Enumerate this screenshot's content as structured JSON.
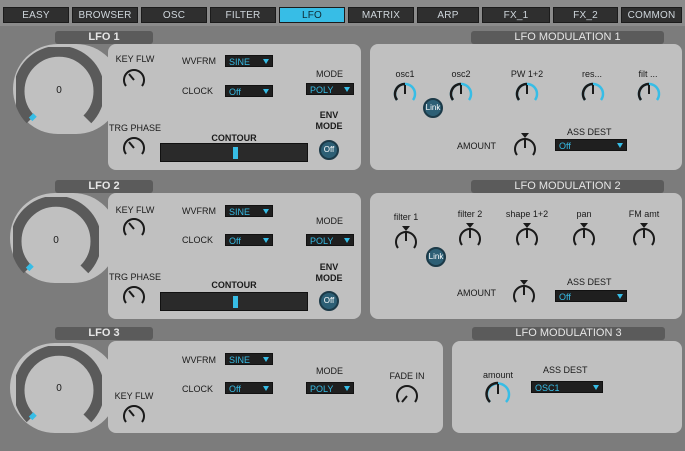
{
  "tabs": [
    "EASY",
    "BROWSER",
    "OSC",
    "FILTER",
    "LFO",
    "MATRIX",
    "ARP",
    "FX_1",
    "FX_2",
    "COMMON"
  ],
  "active_tab": "LFO",
  "accent": "#37bde6",
  "lfo1": {
    "title": "LFO 1",
    "rate_value": "0",
    "key_flw_label": "KEY FLW",
    "trg_phase_label": "TRG PHASE",
    "wvfrm_label": "WVFRM",
    "wvfrm_value": "SINE",
    "clock_label": "CLOCK",
    "clock_value": "Off",
    "mode_label": "MODE",
    "mode_value": "POLY",
    "contour_label": "CONTOUR",
    "env_mode_label1": "ENV",
    "env_mode_label2": "MODE",
    "env_mode_value": "Off"
  },
  "lfo2": {
    "title": "LFO 2",
    "rate_value": "0",
    "key_flw_label": "KEY FLW",
    "trg_phase_label": "TRG PHASE",
    "wvfrm_label": "WVFRM",
    "wvfrm_value": "SINE",
    "clock_label": "CLOCK",
    "clock_value": "Off",
    "mode_label": "MODE",
    "mode_value": "POLY",
    "contour_label": "CONTOUR",
    "env_mode_label1": "ENV",
    "env_mode_label2": "MODE",
    "env_mode_value": "Off"
  },
  "lfo3": {
    "title": "LFO 3",
    "rate_value": "0",
    "key_flw_label": "KEY FLW",
    "wvfrm_label": "WVFRM",
    "wvfrm_value": "SINE",
    "clock_label": "CLOCK",
    "clock_value": "Off",
    "mode_label": "MODE",
    "mode_value": "POLY",
    "fade_in_label": "FADE IN"
  },
  "mod1": {
    "title": "LFO MODULATION 1",
    "targets": [
      "osc1",
      "osc2",
      "PW 1+2",
      "res...",
      "filt ..."
    ],
    "link_label": "Link",
    "amount_label": "AMOUNT",
    "ass_dest_label": "ASS DEST",
    "ass_dest_value": "Off"
  },
  "mod2": {
    "title": "LFO MODULATION 2",
    "targets": [
      "filter 1",
      "filter 2",
      "shape 1+2",
      "pan",
      "FM amt"
    ],
    "link_label": "Link",
    "amount_label": "AMOUNT",
    "ass_dest_label": "ASS DEST",
    "ass_dest_value": "Off"
  },
  "mod3": {
    "title": "LFO MODULATION 3",
    "amount_label": "amount",
    "ass_dest_label": "ASS DEST",
    "ass_dest_value": "OSC1"
  }
}
